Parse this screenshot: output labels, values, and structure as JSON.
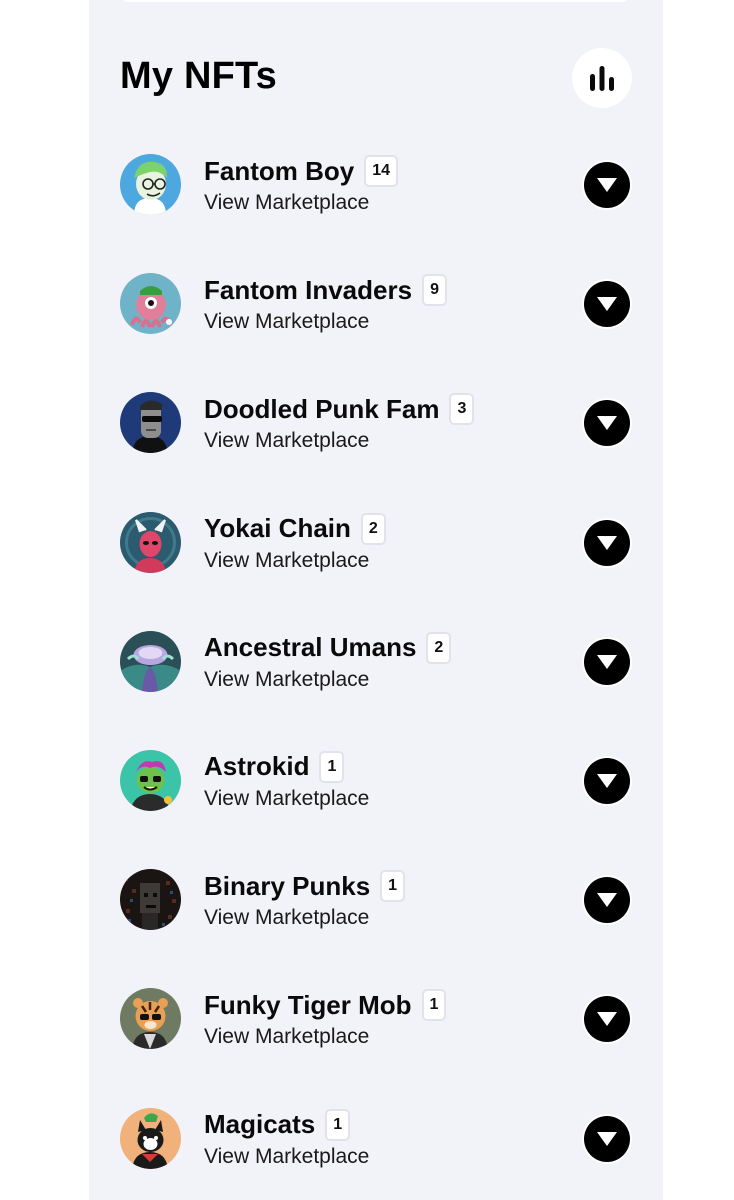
{
  "header": {
    "title": "My NFTs",
    "stats_icon": "bar-chart-icon"
  },
  "collections": [
    {
      "name": "Fantom Boy",
      "count": "14",
      "link": "View Marketplace",
      "avatar": "fantom-boy-avatar"
    },
    {
      "name": "Fantom Invaders",
      "count": "9",
      "link": "View Marketplace",
      "avatar": "fantom-invaders-avatar"
    },
    {
      "name": "Doodled Punk Fam",
      "count": "3",
      "link": "View Marketplace",
      "avatar": "doodled-punk-fam-avatar"
    },
    {
      "name": "Yokai Chain",
      "count": "2",
      "link": "View Marketplace",
      "avatar": "yokai-chain-avatar"
    },
    {
      "name": "Ancestral Umans",
      "count": "2",
      "link": "View Marketplace",
      "avatar": "ancestral-umans-avatar"
    },
    {
      "name": "Astrokid",
      "count": "1",
      "link": "View Marketplace",
      "avatar": "astrokid-avatar"
    },
    {
      "name": "Binary Punks",
      "count": "1",
      "link": "View Marketplace",
      "avatar": "binary-punks-avatar"
    },
    {
      "name": "Funky Tiger Mob",
      "count": "1",
      "link": "View Marketplace",
      "avatar": "funky-tiger-mob-avatar"
    },
    {
      "name": "Magicats",
      "count": "1",
      "link": "View Marketplace",
      "avatar": "magicats-avatar"
    }
  ],
  "colors": {
    "panel_background": "#f2f2f9",
    "expand_button": "#000000"
  }
}
